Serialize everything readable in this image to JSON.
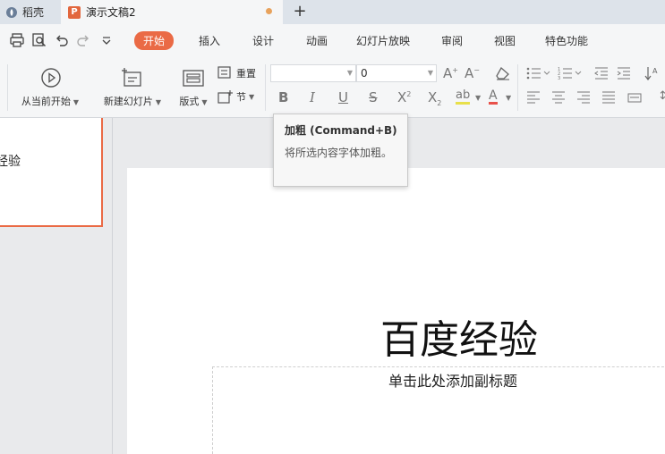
{
  "tabs": {
    "home_tab": "稻壳",
    "doc_tab": "演示文稿2",
    "new_tab": "+"
  },
  "menu": {
    "items": [
      "开始",
      "插入",
      "设计",
      "动画",
      "幻灯片放映",
      "审阅",
      "视图",
      "特色功能"
    ],
    "active": "开始"
  },
  "ribbon": {
    "play_from_current": "从当前开始",
    "new_slide": "新建幻灯片",
    "layout": "版式",
    "reset": "重置",
    "section": "节",
    "font_name": "",
    "font_size": "0"
  },
  "tooltip": {
    "title": "加粗 (Command+B)",
    "desc": "将所选内容字体加粗。"
  },
  "slides_panel": {
    "thumb_text": "经验"
  },
  "slide": {
    "title": "百度经验",
    "subtitle_placeholder": "单击此处添加副标题"
  },
  "colors": {
    "accent": "#ea6a45",
    "doc_icon": "#e2663d",
    "modified_dot": "#e8a25c"
  }
}
